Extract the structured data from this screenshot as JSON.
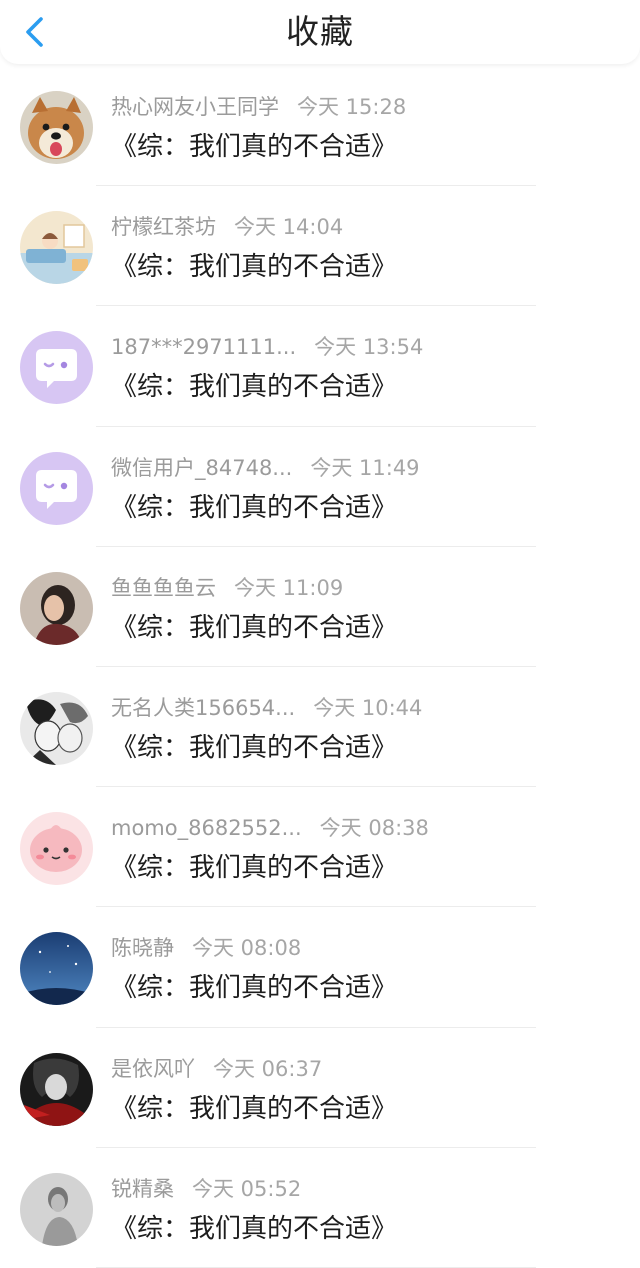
{
  "header": {
    "title": "收藏"
  },
  "colors": {
    "accent": "#2b9df0",
    "purple_avatar": "#d7c6f3"
  },
  "items": [
    {
      "name": "热心网友小王同学",
      "time": "今天 15:28",
      "content": "《综：我们真的不合适》",
      "avatar": "shiba-dog"
    },
    {
      "name": "柠檬红茶坊",
      "time": "今天 14:04",
      "content": "《综：我们真的不合适》",
      "avatar": "anime-room"
    },
    {
      "name": "187***2971111...",
      "time": "今天 13:54",
      "content": "《综：我们真的不合适》",
      "avatar": "default-chat-bubble"
    },
    {
      "name": "微信用户_84748...",
      "time": "今天 11:49",
      "content": "《综：我们真的不合适》",
      "avatar": "default-chat-bubble"
    },
    {
      "name": "鱼鱼鱼鱼云",
      "time": "今天 11:09",
      "content": "《综：我们真的不合适》",
      "avatar": "girl-portrait"
    },
    {
      "name": "无名人类156654...",
      "time": "今天 10:44",
      "content": "《综：我们真的不合适》",
      "avatar": "manga-sketch"
    },
    {
      "name": "momo_8682552...",
      "time": "今天 08:38",
      "content": "《综：我们真的不合适》",
      "avatar": "pink-creature"
    },
    {
      "name": "陈晓静",
      "time": "今天 08:08",
      "content": "《综：我们真的不合适》",
      "avatar": "blue-night-sky"
    },
    {
      "name": "是依风吖",
      "time": "今天 06:37",
      "content": "《综：我们真的不合适》",
      "avatar": "dark-anime"
    },
    {
      "name": "锐精桑",
      "time": "今天 05:52",
      "content": "《综：我们真的不合适》",
      "avatar": "bw-photo"
    }
  ]
}
